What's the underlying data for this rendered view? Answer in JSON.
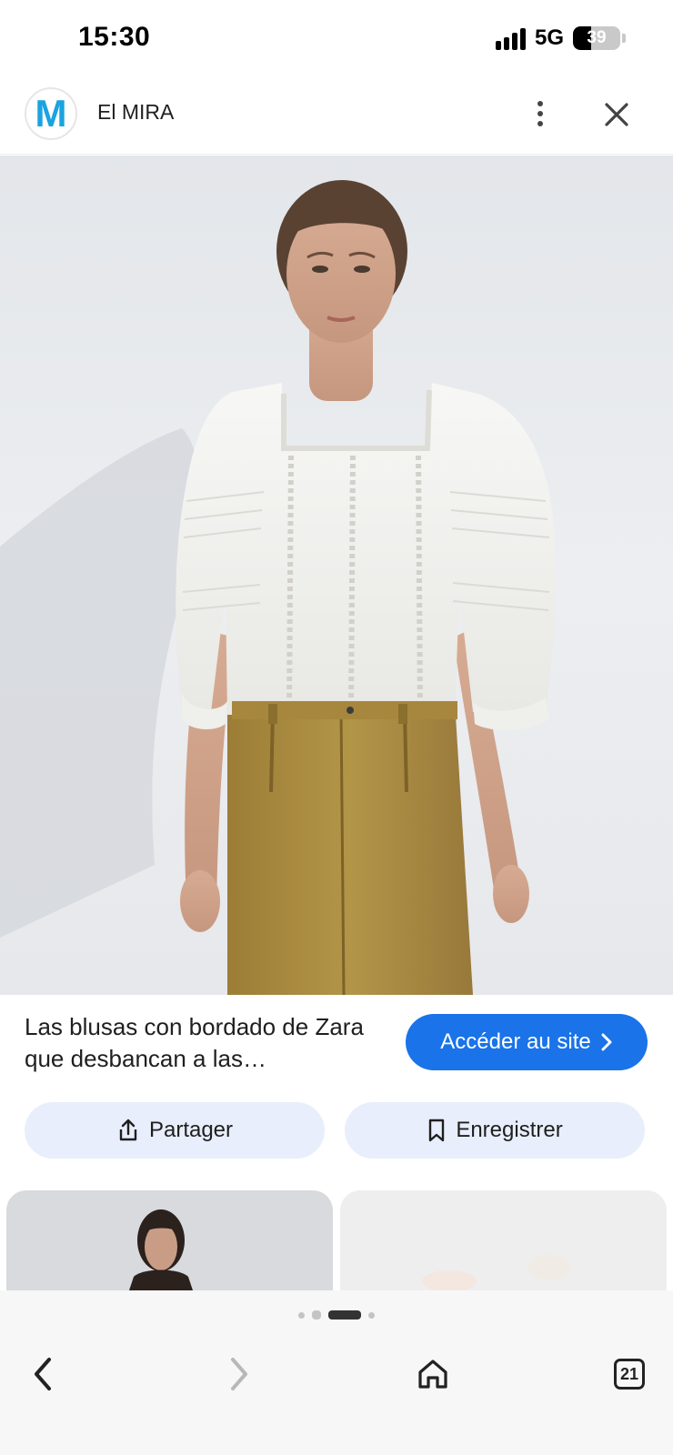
{
  "status_bar": {
    "time": "15:30",
    "network": "5G",
    "battery_percent": "39",
    "battery_level": 0.39
  },
  "header": {
    "logo_letter": "M",
    "site_name": "El MIRA",
    "more_icon": "more-vert-icon",
    "close_icon": "close-icon"
  },
  "hero": {
    "image_subject": "model wearing white embroidered blouse and mustard trousers"
  },
  "result": {
    "title": "Las blusas con bordado de Zara que desbancan a las…",
    "visit_label": "Accéder au site",
    "visit_icon": "chevron-right-icon",
    "accent_color": "#1a73e8"
  },
  "actions": {
    "share_label": "Partager",
    "share_icon": "share-icon",
    "save_label": "Enregistrer",
    "save_icon": "bookmark-icon"
  },
  "bottom_nav": {
    "back_icon": "back-arrow-icon",
    "forward_icon": "forward-arrow-icon",
    "home_icon": "home-icon",
    "tabs_count": "21"
  }
}
